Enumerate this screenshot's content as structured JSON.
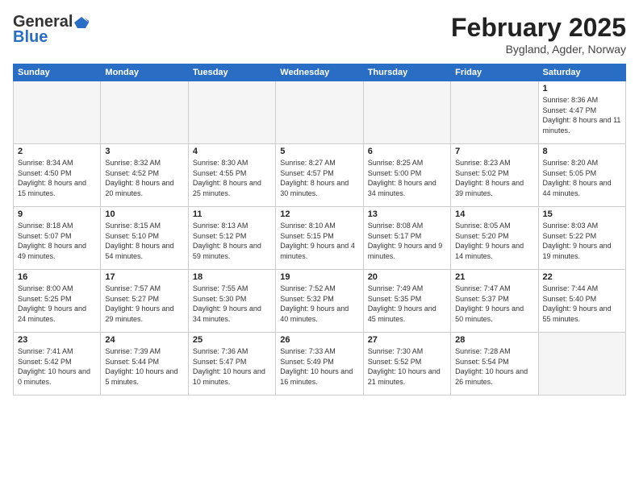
{
  "header": {
    "logo_general": "General",
    "logo_blue": "Blue",
    "main_title": "February 2025",
    "subtitle": "Bygland, Agder, Norway"
  },
  "calendar": {
    "weekdays": [
      "Sunday",
      "Monday",
      "Tuesday",
      "Wednesday",
      "Thursday",
      "Friday",
      "Saturday"
    ],
    "weeks": [
      [
        {
          "day": "",
          "info": ""
        },
        {
          "day": "",
          "info": ""
        },
        {
          "day": "",
          "info": ""
        },
        {
          "day": "",
          "info": ""
        },
        {
          "day": "",
          "info": ""
        },
        {
          "day": "",
          "info": ""
        },
        {
          "day": "1",
          "info": "Sunrise: 8:36 AM\nSunset: 4:47 PM\nDaylight: 8 hours and 11 minutes."
        }
      ],
      [
        {
          "day": "2",
          "info": "Sunrise: 8:34 AM\nSunset: 4:50 PM\nDaylight: 8 hours and 15 minutes."
        },
        {
          "day": "3",
          "info": "Sunrise: 8:32 AM\nSunset: 4:52 PM\nDaylight: 8 hours and 20 minutes."
        },
        {
          "day": "4",
          "info": "Sunrise: 8:30 AM\nSunset: 4:55 PM\nDaylight: 8 hours and 25 minutes."
        },
        {
          "day": "5",
          "info": "Sunrise: 8:27 AM\nSunset: 4:57 PM\nDaylight: 8 hours and 30 minutes."
        },
        {
          "day": "6",
          "info": "Sunrise: 8:25 AM\nSunset: 5:00 PM\nDaylight: 8 hours and 34 minutes."
        },
        {
          "day": "7",
          "info": "Sunrise: 8:23 AM\nSunset: 5:02 PM\nDaylight: 8 hours and 39 minutes."
        },
        {
          "day": "8",
          "info": "Sunrise: 8:20 AM\nSunset: 5:05 PM\nDaylight: 8 hours and 44 minutes."
        }
      ],
      [
        {
          "day": "9",
          "info": "Sunrise: 8:18 AM\nSunset: 5:07 PM\nDaylight: 8 hours and 49 minutes."
        },
        {
          "day": "10",
          "info": "Sunrise: 8:15 AM\nSunset: 5:10 PM\nDaylight: 8 hours and 54 minutes."
        },
        {
          "day": "11",
          "info": "Sunrise: 8:13 AM\nSunset: 5:12 PM\nDaylight: 8 hours and 59 minutes."
        },
        {
          "day": "12",
          "info": "Sunrise: 8:10 AM\nSunset: 5:15 PM\nDaylight: 9 hours and 4 minutes."
        },
        {
          "day": "13",
          "info": "Sunrise: 8:08 AM\nSunset: 5:17 PM\nDaylight: 9 hours and 9 minutes."
        },
        {
          "day": "14",
          "info": "Sunrise: 8:05 AM\nSunset: 5:20 PM\nDaylight: 9 hours and 14 minutes."
        },
        {
          "day": "15",
          "info": "Sunrise: 8:03 AM\nSunset: 5:22 PM\nDaylight: 9 hours and 19 minutes."
        }
      ],
      [
        {
          "day": "16",
          "info": "Sunrise: 8:00 AM\nSunset: 5:25 PM\nDaylight: 9 hours and 24 minutes."
        },
        {
          "day": "17",
          "info": "Sunrise: 7:57 AM\nSunset: 5:27 PM\nDaylight: 9 hours and 29 minutes."
        },
        {
          "day": "18",
          "info": "Sunrise: 7:55 AM\nSunset: 5:30 PM\nDaylight: 9 hours and 34 minutes."
        },
        {
          "day": "19",
          "info": "Sunrise: 7:52 AM\nSunset: 5:32 PM\nDaylight: 9 hours and 40 minutes."
        },
        {
          "day": "20",
          "info": "Sunrise: 7:49 AM\nSunset: 5:35 PM\nDaylight: 9 hours and 45 minutes."
        },
        {
          "day": "21",
          "info": "Sunrise: 7:47 AM\nSunset: 5:37 PM\nDaylight: 9 hours and 50 minutes."
        },
        {
          "day": "22",
          "info": "Sunrise: 7:44 AM\nSunset: 5:40 PM\nDaylight: 9 hours and 55 minutes."
        }
      ],
      [
        {
          "day": "23",
          "info": "Sunrise: 7:41 AM\nSunset: 5:42 PM\nDaylight: 10 hours and 0 minutes."
        },
        {
          "day": "24",
          "info": "Sunrise: 7:39 AM\nSunset: 5:44 PM\nDaylight: 10 hours and 5 minutes."
        },
        {
          "day": "25",
          "info": "Sunrise: 7:36 AM\nSunset: 5:47 PM\nDaylight: 10 hours and 10 minutes."
        },
        {
          "day": "26",
          "info": "Sunrise: 7:33 AM\nSunset: 5:49 PM\nDaylight: 10 hours and 16 minutes."
        },
        {
          "day": "27",
          "info": "Sunrise: 7:30 AM\nSunset: 5:52 PM\nDaylight: 10 hours and 21 minutes."
        },
        {
          "day": "28",
          "info": "Sunrise: 7:28 AM\nSunset: 5:54 PM\nDaylight: 10 hours and 26 minutes."
        },
        {
          "day": "",
          "info": ""
        }
      ]
    ]
  }
}
